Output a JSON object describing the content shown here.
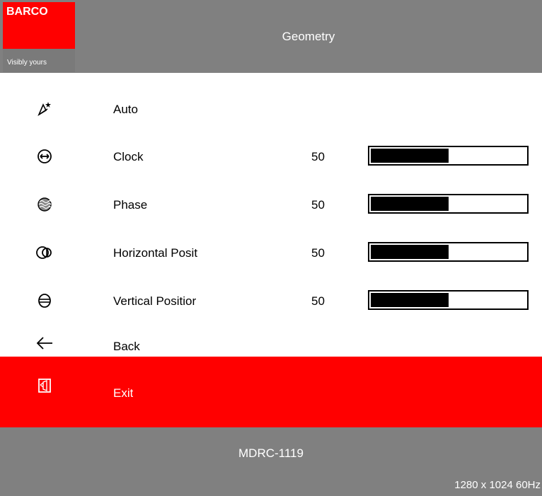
{
  "header": {
    "brand": "BARCO",
    "tagline": "Visibly yours",
    "title": "Geometry"
  },
  "menu": {
    "items": [
      {
        "label": "Auto",
        "icon": "auto-adjust-icon"
      },
      {
        "label": "Clock",
        "icon": "clock-width-icon",
        "value": "50",
        "level": 0.5
      },
      {
        "label": "Phase",
        "icon": "phase-icon",
        "value": "50",
        "level": 0.5
      },
      {
        "label": "Horizontal Posit",
        "icon": "horizontal-position-icon",
        "value": "50",
        "level": 0.5
      },
      {
        "label": "Vertical Positior",
        "icon": "vertical-position-icon",
        "value": "50",
        "level": 0.5
      },
      {
        "label": "Back",
        "icon": "back-arrow-icon"
      },
      {
        "label": "Exit",
        "icon": "exit-icon",
        "selected": true
      }
    ]
  },
  "footer": {
    "model": "MDRC-1119",
    "resolution": "1280 x 1024 60Hz"
  },
  "colors": {
    "header_gray": "#808080",
    "brand_red": "#ff0000",
    "selection_red": "#ff0000",
    "text_white": "#ffffff"
  }
}
